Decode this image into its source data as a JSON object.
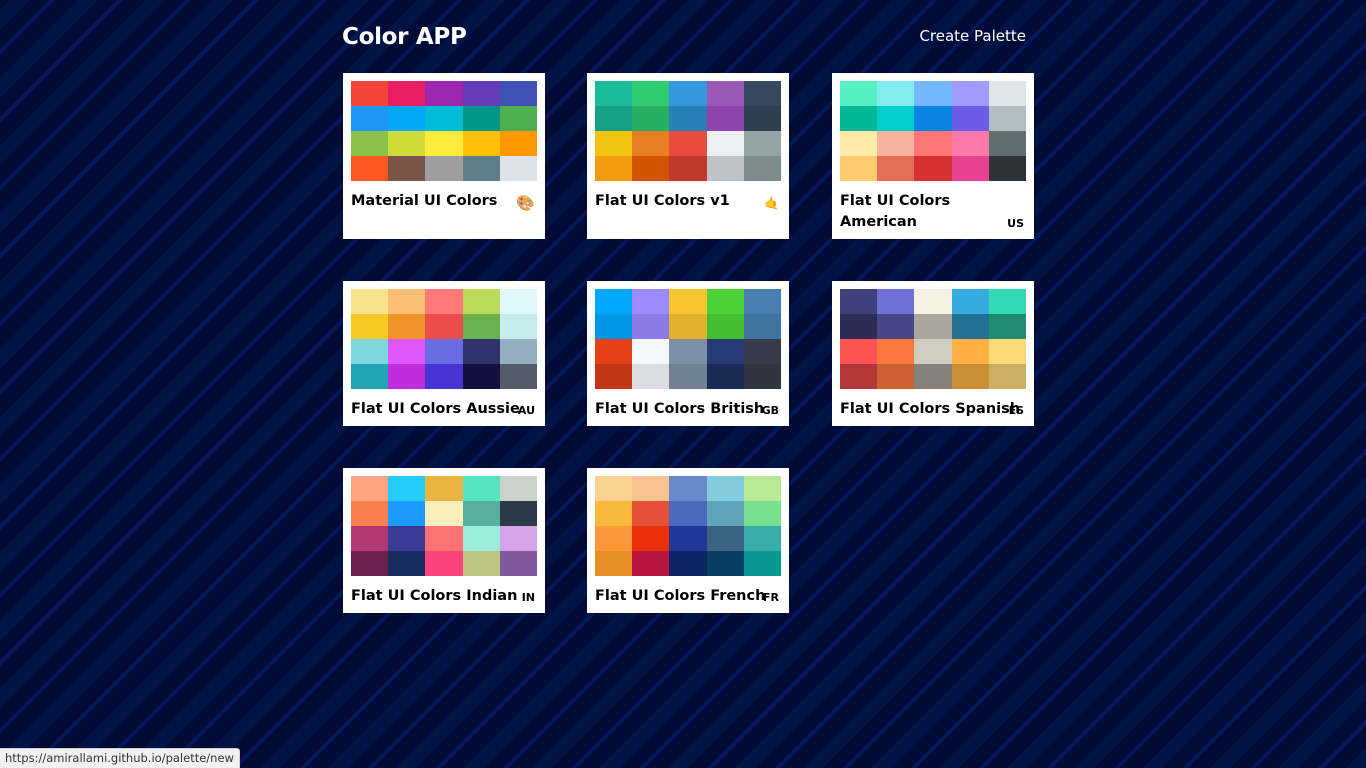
{
  "header": {
    "title": "Color APP",
    "create_link": "Create Palette"
  },
  "palettes": [
    {
      "name": "Material UI Colors",
      "emoji": "🎨",
      "colors": [
        "#f44336",
        "#e91e63",
        "#9c27b0",
        "#673ab7",
        "#3f51b5",
        "#2196f3",
        "#03a9f4",
        "#00bcd4",
        "#009688",
        "#4caf50",
        "#8bc34a",
        "#cddc39",
        "#ffeb3b",
        "#ffc107",
        "#ff9800",
        "#ff5722",
        "#795548",
        "#9e9e9e",
        "#607d8b",
        "#dde3e6"
      ]
    },
    {
      "name": "Flat UI Colors v1",
      "emoji": "🤙",
      "colors": [
        "#1abc9c",
        "#2ecc71",
        "#3498db",
        "#9b59b6",
        "#34495e",
        "#16a085",
        "#27ae60",
        "#2980b9",
        "#8e44ad",
        "#2c3e50",
        "#f1c40f",
        "#e67e22",
        "#e74c3c",
        "#ecf0f1",
        "#95a5a6",
        "#f39c12",
        "#d35400",
        "#c0392b",
        "#bdc3c7",
        "#7f8c8d"
      ]
    },
    {
      "name": "Flat UI Colors American",
      "emoji": "US",
      "colors": [
        "#55efc4",
        "#81ecec",
        "#74b9ff",
        "#a29bfe",
        "#dfe6e9",
        "#00b894",
        "#00cec9",
        "#0984e3",
        "#6c5ce7",
        "#b2bec3",
        "#ffeaa7",
        "#fab1a0",
        "#ff7675",
        "#fd79a8",
        "#636e72",
        "#fdcb6e",
        "#e17055",
        "#d63031",
        "#e84393",
        "#2d3436"
      ]
    },
    {
      "name": "Flat UI Colors Aussie",
      "emoji": "AU",
      "colors": [
        "#f6e58d",
        "#ffbe76",
        "#ff7979",
        "#badc58",
        "#dff9fb",
        "#f9ca24",
        "#f0932b",
        "#eb4d4b",
        "#6ab04c",
        "#c7ecee",
        "#7ed6df",
        "#e056fd",
        "#686de0",
        "#30336b",
        "#95afc0",
        "#22a6b3",
        "#be2edd",
        "#4834d4",
        "#130f40",
        "#535c68"
      ]
    },
    {
      "name": "Flat UI Colors British",
      "emoji": "GB",
      "colors": [
        "#00a8ff",
        "#9c88ff",
        "#fbc531",
        "#4cd137",
        "#487eb0",
        "#0097e6",
        "#8c7ae6",
        "#e1b12c",
        "#44bd32",
        "#40739e",
        "#e84118",
        "#f5f6fa",
        "#7f8fa6",
        "#273c75",
        "#353b48",
        "#c23616",
        "#dcdde1",
        "#718093",
        "#192a56",
        "#2f3640"
      ]
    },
    {
      "name": "Flat UI Colors Spanish",
      "emoji": "ES",
      "colors": [
        "#40407a",
        "#706fd3",
        "#f7f1e3",
        "#34ace0",
        "#33d9b2",
        "#2c2c54",
        "#474787",
        "#aaa69d",
        "#227093",
        "#218c74",
        "#ff5252",
        "#ff793f",
        "#d1ccc0",
        "#ffb142",
        "#ffda79",
        "#b33939",
        "#cd6133",
        "#84817a",
        "#cc8e35",
        "#ccae62"
      ]
    },
    {
      "name": "Flat UI Colors Indian",
      "emoji": "IN",
      "colors": [
        "#fea47f",
        "#25ccf7",
        "#eab543",
        "#55e6c1",
        "#cad3c8",
        "#f97f51",
        "#1b9cfc",
        "#f8efba",
        "#58b19f",
        "#2c3a47",
        "#b33771",
        "#3b3b98",
        "#fd7272",
        "#9aecdb",
        "#d6a2e8",
        "#6d214f",
        "#182c61",
        "#fc427b",
        "#bdc581",
        "#82589f"
      ]
    },
    {
      "name": "Flat UI Colors French",
      "emoji": "FR",
      "colors": [
        "#fad390",
        "#f8c291",
        "#6a89cc",
        "#82ccdd",
        "#b8e994",
        "#f6b93b",
        "#e55039",
        "#4a69bd",
        "#60a3bc",
        "#78e08f",
        "#fa983a",
        "#eb2f06",
        "#1e3799",
        "#3c6382",
        "#38ada9",
        "#e58e26",
        "#b71540",
        "#0c2461",
        "#0a3d62",
        "#079992"
      ]
    }
  ],
  "status_bar": {
    "url": "https://amirallami.github.io/palette/new"
  }
}
